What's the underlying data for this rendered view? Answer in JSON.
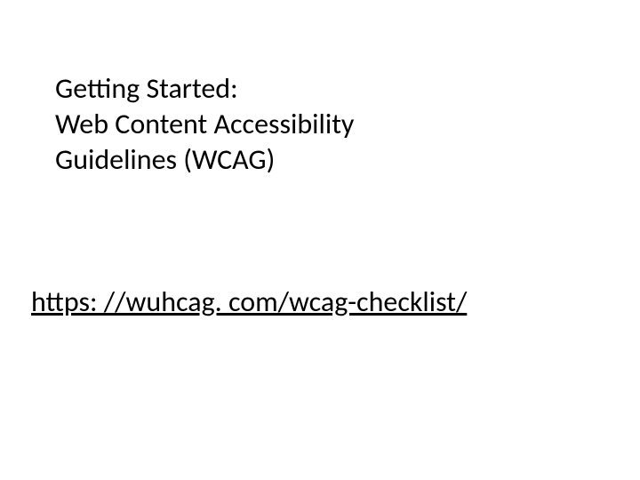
{
  "title": {
    "line1": "Getting Started:",
    "line2": "Web Content Accessibility",
    "line3": "Guidelines (WCAG)"
  },
  "link": {
    "text": "https: //wuhcag. com/wcag-checklist/"
  }
}
